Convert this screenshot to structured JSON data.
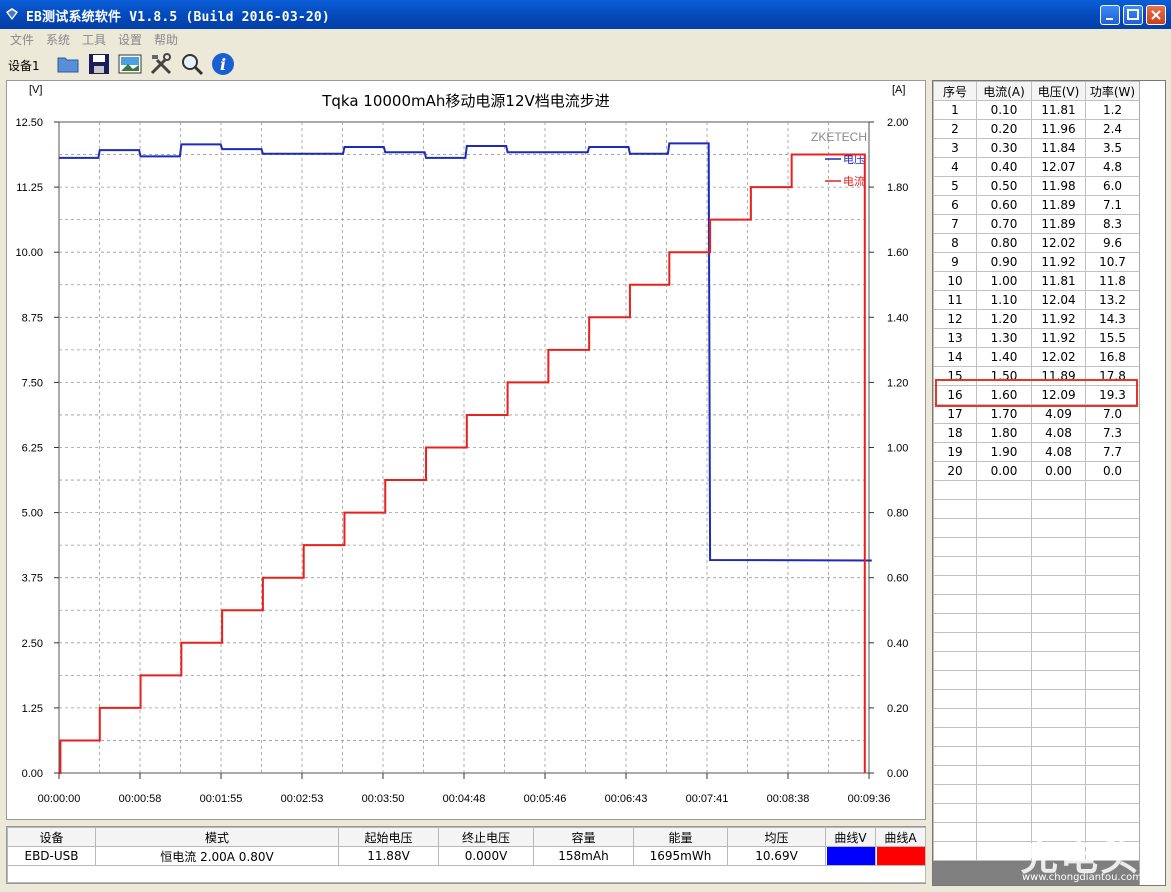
{
  "window": {
    "title": "EB测试系统软件 V1.8.5 (Build 2016-03-20)"
  },
  "menu": [
    "文件",
    "系统",
    "工具",
    "设置",
    "帮助"
  ],
  "toolbar": {
    "device_tab": "设备1",
    "icons": [
      "open-folder-icon",
      "save-icon",
      "image-icon",
      "tools-icon",
      "search-icon",
      "info-icon"
    ]
  },
  "chart_data": {
    "type": "line",
    "title": "Tqka 10000mAh移动电源12V档电流步进",
    "brand": "ZKETECH",
    "left_unit": "[V]",
    "right_unit": "[A]",
    "y_left_ticks": [
      "12.50",
      "11.25",
      "10.00",
      "8.75",
      "7.50",
      "6.25",
      "5.00",
      "3.75",
      "2.50",
      "1.25",
      "0.00"
    ],
    "y_right_ticks": [
      "2.00",
      "1.80",
      "1.60",
      "1.40",
      "1.20",
      "1.00",
      "0.80",
      "0.60",
      "0.40",
      "0.20",
      "0.00"
    ],
    "x_ticks": [
      "00:00:00",
      "00:00:58",
      "00:01:55",
      "00:02:53",
      "00:03:50",
      "00:04:48",
      "00:05:46",
      "00:06:43",
      "00:07:41",
      "00:08:38",
      "00:09:36"
    ],
    "ylim_left": [
      0,
      12.5
    ],
    "ylim_right": [
      0,
      2.0
    ],
    "xlim_seconds": [
      0,
      576
    ],
    "legend": [
      {
        "name": "电压",
        "color": "#1c2bb8"
      },
      {
        "name": "电流",
        "color": "#e8211c"
      }
    ],
    "series": [
      {
        "name": "电压",
        "axis": "left",
        "color": "#1c2bb8",
        "x": [
          0,
          28,
          29,
          57,
          58,
          86,
          87,
          115,
          116,
          144,
          145,
          173,
          174,
          202,
          203,
          231,
          232,
          260,
          261,
          289,
          290,
          318,
          319,
          347,
          348,
          376,
          377,
          405,
          406,
          433,
          434,
          462,
          463,
          577,
          578
        ],
        "y": [
          11.81,
          11.81,
          11.96,
          11.96,
          11.84,
          11.84,
          12.07,
          12.07,
          11.98,
          11.98,
          11.89,
          11.89,
          11.89,
          11.89,
          12.02,
          12.02,
          11.92,
          11.92,
          11.81,
          11.81,
          12.04,
          12.04,
          11.92,
          11.92,
          11.92,
          11.92,
          12.02,
          12.02,
          11.89,
          11.89,
          12.09,
          12.09,
          4.09,
          4.08,
          4.08
        ]
      },
      {
        "name": "电流",
        "axis": "right",
        "color": "#e8211c",
        "x": [
          0,
          1,
          29,
          58,
          87,
          116,
          145,
          174,
          203,
          232,
          261,
          290,
          319,
          348,
          377,
          406,
          434,
          463,
          492,
          521,
          550,
          573
        ],
        "y": [
          0,
          0.1,
          0.2,
          0.3,
          0.4,
          0.5,
          0.6,
          0.7,
          0.8,
          0.9,
          1.0,
          1.1,
          1.2,
          1.3,
          1.4,
          1.5,
          1.6,
          1.7,
          1.8,
          1.9,
          1.9,
          0
        ]
      }
    ]
  },
  "table": {
    "headers": [
      "序号",
      "电流(A)",
      "电压(V)",
      "功率(W)"
    ],
    "rows": [
      [
        "1",
        "0.10",
        "11.81",
        "1.2"
      ],
      [
        "2",
        "0.20",
        "11.96",
        "2.4"
      ],
      [
        "3",
        "0.30",
        "11.84",
        "3.5"
      ],
      [
        "4",
        "0.40",
        "12.07",
        "4.8"
      ],
      [
        "5",
        "0.50",
        "11.98",
        "6.0"
      ],
      [
        "6",
        "0.60",
        "11.89",
        "7.1"
      ],
      [
        "7",
        "0.70",
        "11.89",
        "8.3"
      ],
      [
        "8",
        "0.80",
        "12.02",
        "9.6"
      ],
      [
        "9",
        "0.90",
        "11.92",
        "10.7"
      ],
      [
        "10",
        "1.00",
        "11.81",
        "11.8"
      ],
      [
        "11",
        "1.10",
        "12.04",
        "13.2"
      ],
      [
        "12",
        "1.20",
        "11.92",
        "14.3"
      ],
      [
        "13",
        "1.30",
        "11.92",
        "15.5"
      ],
      [
        "14",
        "1.40",
        "12.02",
        "16.8"
      ],
      [
        "15",
        "1.50",
        "11.89",
        "17.8"
      ],
      [
        "16",
        "1.60",
        "12.09",
        "19.3"
      ],
      [
        "17",
        "1.70",
        "4.09",
        "7.0"
      ],
      [
        "18",
        "1.80",
        "4.08",
        "7.3"
      ],
      [
        "19",
        "1.90",
        "4.08",
        "7.7"
      ],
      [
        "20",
        "0.00",
        "0.00",
        "0.0"
      ]
    ],
    "highlight_row": 16
  },
  "summary": {
    "headers": [
      "设备",
      "模式",
      "起始电压",
      "终止电压",
      "容量",
      "能量",
      "均压",
      "曲线V",
      "曲线A"
    ],
    "row": [
      "EBD-USB",
      "恒电流 2.00A 0.80V",
      "11.88V",
      "0.000V",
      "158mAh",
      "1695mWh",
      "10.69V"
    ],
    "curve_colors": [
      "#0000ff",
      "#ff0000"
    ]
  },
  "watermark": {
    "text": "充电头",
    "url": "www.chongdiantou.com"
  }
}
